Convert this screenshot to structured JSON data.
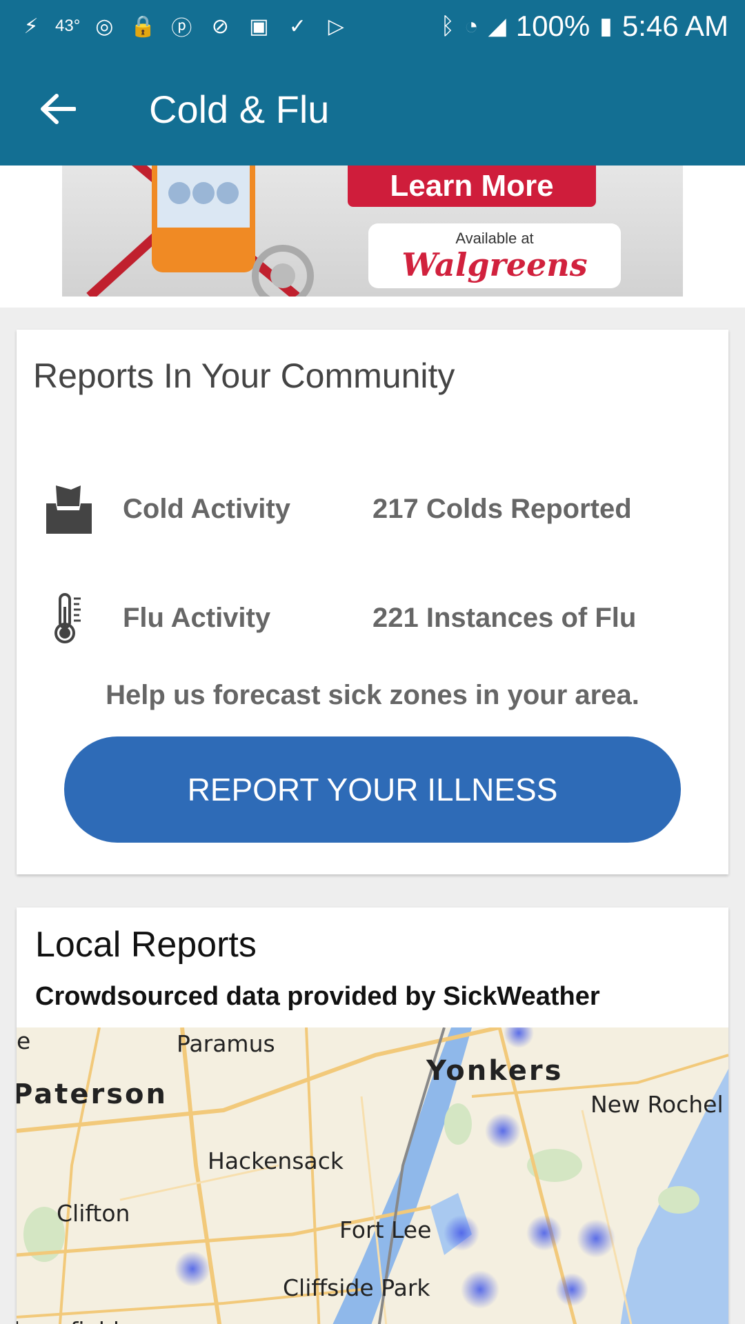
{
  "status_bar": {
    "temperature": "43°",
    "battery": "100%",
    "time": "5:46 AM"
  },
  "app_bar": {
    "title": "Cold & Flu"
  },
  "ad": {
    "cta": "Learn More",
    "available": "Available at",
    "brand": "Walgreens"
  },
  "community": {
    "title": "Reports In Your Community",
    "rows": [
      {
        "icon": "tissue-box-icon",
        "label": "Cold Activity",
        "value": "217 Colds Reported"
      },
      {
        "icon": "thermometer-icon",
        "label": "Flu Activity",
        "value": "221 Instances of Flu"
      }
    ],
    "help": "Help us forecast sick zones in your area.",
    "button": "REPORT YOUR ILLNESS"
  },
  "local": {
    "title": "Local Reports",
    "subtitle": "Crowdsourced data provided by SickWeather",
    "map_places": [
      "e",
      "Paramus",
      "Yonkers",
      "Paterson",
      "New Rochel",
      "Hackensack",
      "Clifton",
      "Fort Lee",
      "Cliffside Park",
      "loomfield"
    ]
  },
  "colors": {
    "header": "#136f93",
    "button": "#2e6bb7",
    "ad_red": "#cf1d3b"
  }
}
